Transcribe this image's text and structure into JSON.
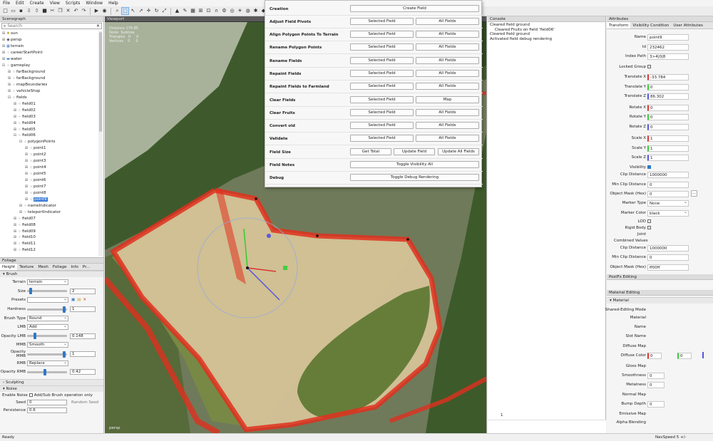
{
  "menu": [
    "File",
    "Edit",
    "Create",
    "View",
    "Scripts",
    "Window",
    "Help"
  ],
  "scenegraph": {
    "title": "Scenegraph",
    "search_placeholder": "Search",
    "items": [
      {
        "label": "sun",
        "depth": 0,
        "icon": "light-icon"
      },
      {
        "label": "persp",
        "depth": 0,
        "icon": "camera-icon"
      },
      {
        "label": "terrain",
        "depth": 0,
        "icon": "terrain-icon"
      },
      {
        "label": "careerStartPoint",
        "depth": 0,
        "icon": "transform-icon"
      },
      {
        "label": "water",
        "depth": 0,
        "icon": "water-icon"
      },
      {
        "label": "gameplay",
        "depth": 0,
        "icon": "transform-icon",
        "expanded": true
      },
      {
        "label": "farBackground",
        "depth": 1,
        "icon": "transform-icon"
      },
      {
        "label": "farBackground",
        "depth": 1,
        "icon": "transform-icon"
      },
      {
        "label": "mapBoundaries",
        "depth": 1,
        "icon": "transform-icon"
      },
      {
        "label": "vehicleShop",
        "depth": 1,
        "icon": "transform-icon"
      },
      {
        "label": "fields",
        "depth": 1,
        "icon": "transform-icon",
        "expanded": true
      },
      {
        "label": "field01",
        "depth": 2,
        "icon": "transform-icon"
      },
      {
        "label": "field02",
        "depth": 2,
        "icon": "transform-icon"
      },
      {
        "label": "field03",
        "depth": 2,
        "icon": "transform-icon"
      },
      {
        "label": "field04",
        "depth": 2,
        "icon": "transform-icon"
      },
      {
        "label": "field05",
        "depth": 2,
        "icon": "transform-icon"
      },
      {
        "label": "field06",
        "depth": 2,
        "icon": "transform-icon",
        "expanded": true
      },
      {
        "label": "polygonPoints",
        "depth": 3,
        "icon": "transform-icon",
        "expanded": true
      },
      {
        "label": "point1",
        "depth": 4,
        "icon": "transform-icon"
      },
      {
        "label": "point2",
        "depth": 4,
        "icon": "transform-icon"
      },
      {
        "label": "point3",
        "depth": 4,
        "icon": "transform-icon"
      },
      {
        "label": "point4",
        "depth": 4,
        "icon": "transform-icon"
      },
      {
        "label": "point5",
        "depth": 4,
        "icon": "transform-icon"
      },
      {
        "label": "point6",
        "depth": 4,
        "icon": "transform-icon"
      },
      {
        "label": "point7",
        "depth": 4,
        "icon": "transform-icon"
      },
      {
        "label": "point8",
        "depth": 4,
        "icon": "transform-icon"
      },
      {
        "label": "point9",
        "depth": 4,
        "icon": "transform-icon",
        "selected": true
      },
      {
        "label": "nameIndicator",
        "depth": 3,
        "icon": "transform-icon"
      },
      {
        "label": "teleportIndicator",
        "depth": 3,
        "icon": "transform-icon"
      },
      {
        "label": "field07",
        "depth": 2,
        "icon": "transform-icon"
      },
      {
        "label": "field08",
        "depth": 2,
        "icon": "transform-icon"
      },
      {
        "label": "field09",
        "depth": 2,
        "icon": "transform-icon"
      },
      {
        "label": "field10",
        "depth": 2,
        "icon": "transform-icon"
      },
      {
        "label": "field11",
        "depth": 2,
        "icon": "transform-icon"
      },
      {
        "label": "field12",
        "depth": 2,
        "icon": "transform-icon"
      }
    ]
  },
  "foliage": {
    "title": "Foliage",
    "tabs": [
      "Height",
      "Texture",
      "Mesh",
      "Foliage",
      "Info",
      "Pr..."
    ],
    "brush_section": "Brush",
    "terrain_label": "Terrain",
    "terrain_value": "terrain",
    "size_label": "Size",
    "size_value": "2",
    "presets_label": "Presets",
    "hardness_label": "Hardness",
    "hardness_value": "1",
    "brush_type_label": "Brush Type",
    "brush_type_value": "Round",
    "lmb_label": "LMB",
    "lmb_value": "Add",
    "opacity_lmb_label": "Opacity LMB",
    "opacity_lmb_value": "0.148",
    "mmb_label": "MMB",
    "mmb_value": "Smooth",
    "opacity_mmb_label": "Opacity MMB",
    "opacity_mmb_value": "1",
    "rmb_label": "RMB",
    "rmb_value": "Replace",
    "opacity_rmb_label": "Opacity RMB",
    "opacity_rmb_value": "0.42",
    "sculpting_section": "Sculpting",
    "noise_section": "Noise",
    "enable_noise_label": "Enable Noise",
    "add_sub_label": "Add/Sub Brush operation only",
    "seed_label": "Seed",
    "seed_value": "0",
    "random_seed_label": "Random Seed",
    "persistence_label": "Persistence",
    "persistence_value": "0.6"
  },
  "viewport": {
    "title": "Viewport",
    "info_lines": [
      "Distance 176.85",
      "Node  Subtree",
      "Triangles   0     0",
      "Vertices    0     0"
    ],
    "camera_label": "persp"
  },
  "field_menu": {
    "rows": [
      {
        "label": "Creation",
        "buttons": [
          "Create Field"
        ]
      },
      {
        "label": "Adjust Field Pivots",
        "buttons": [
          "Selected Field",
          "All Fields"
        ]
      },
      {
        "label": "Align Polygon Points To Terrain",
        "buttons": [
          "Selected Field",
          "All Fields"
        ]
      },
      {
        "label": "Rename Polygon Points",
        "buttons": [
          "Selected Field",
          "All Fields"
        ]
      },
      {
        "label": "Rename Fields",
        "buttons": [
          "Selected Field",
          "All Fields"
        ]
      },
      {
        "label": "Repaint Fields",
        "buttons": [
          "Selected Field",
          "All Fields"
        ]
      },
      {
        "label": "Repaint Fields to Farmland",
        "buttons": [
          "Selected Field",
          "All Fields"
        ]
      },
      {
        "label": "Clear Fields",
        "buttons": [
          "Selected Field",
          "Map"
        ]
      },
      {
        "label": "Clear Fruits",
        "buttons": [
          "Selected Field",
          "All Fields"
        ]
      },
      {
        "label": "Convert old",
        "buttons": [
          "Selected Field",
          "All Fields"
        ]
      },
      {
        "label": "Validate",
        "buttons": [
          "Selected Field",
          "All Fields"
        ]
      },
      {
        "label": "Field Size",
        "buttons": [
          "Get Total",
          "Update Field",
          "Update All Fields"
        ]
      },
      {
        "label": "Field Notes",
        "buttons": [
          "Toggle Visibility All"
        ]
      },
      {
        "label": "Debug",
        "buttons": [
          "Toggle Debug Rendering"
        ]
      }
    ]
  },
  "console": {
    "title": "Console",
    "lines": [
      "Cleared field ground",
      "    Cleared Fruits on field 'field06'",
      "Cleared field ground",
      "Activated field debug rendering"
    ],
    "line_number": "1"
  },
  "attributes": {
    "title": "Attributes",
    "tabs": [
      "Transform",
      "Visibility Condition",
      "User Attributes"
    ],
    "name_label": "Name",
    "name_value": "point9",
    "id_label": "Id",
    "id_value": "232462",
    "index_label": "Index Path",
    "index_value": "3>4|0|8",
    "locked_label": "Locked Group",
    "tx_label": "Translate X",
    "tx_value": "-33.784",
    "ty_label": "Translate Y",
    "ty_value": "0",
    "tz_label": "Translate Z",
    "tz_value": "86.302",
    "rx_label": "Rotate X",
    "rx_value": "0",
    "ry_label": "Rotate Y",
    "ry_value": "0",
    "rz_label": "Rotate Z",
    "rz_value": "0",
    "sx_label": "Scale X",
    "sx_value": "1",
    "sy_label": "Scale Y",
    "sy_value": "1",
    "sz_label": "Scale Z",
    "sz_value": "1",
    "visibility_label": "Visibility",
    "clip_label": "Clip Distance",
    "clip_value": "1000000",
    "minclip_label": "Min Clip Distance",
    "minclip_value": "0",
    "mask_label": "Object Mask (Hex)",
    "mask_value": "0",
    "markertype_label": "Marker Type",
    "markertype_value": "None",
    "markercolor_label": "Marker Color",
    "markercolor_value": "black",
    "lod_label": "LOD",
    "rigid_label": "Rigid Body",
    "joint_label": "Joint",
    "combined_label": "Combined Values",
    "c_clip_label": "Clip Distance",
    "c_clip_value": "1000000",
    "c_minclip_label": "Min Clip Distance",
    "c_minclip_value": "0",
    "c_mask_label": "Object Mask (Hex)",
    "c_mask_value": "ff00ff",
    "posfx_title": "PostFx Editing",
    "material_title": "Material Editing",
    "material_section": "Material",
    "shared_label": "Shared-Editing Mode",
    "m_material_label": "Material",
    "m_name_label": "Name",
    "m_slot_label": "Slot Name",
    "m_diffusemap_label": "Diffuse Map",
    "m_diffusecolor_label": "Diffuse Color",
    "m_dc1": "0",
    "m_dc2": "0",
    "m_gloss_label": "Gloss Map",
    "m_smooth_label": "Smoothness",
    "m_smooth_value": "0",
    "m_metal_label": "Metalness",
    "m_metal_value": "0",
    "m_normal_label": "Normal Map",
    "m_bump_label": "Bump Depth",
    "m_bump_value": "0",
    "m_emissive_label": "Emissive Map",
    "m_alpha_label": "Alpha Blending"
  },
  "status": {
    "left": "Ready",
    "right": "NavSpeed 5 +/-"
  },
  "colors": {
    "accent": "#2f78c8",
    "selection": "#3a7bd5",
    "field_border": "#e0301e",
    "field_fill": "#d8c49a"
  }
}
